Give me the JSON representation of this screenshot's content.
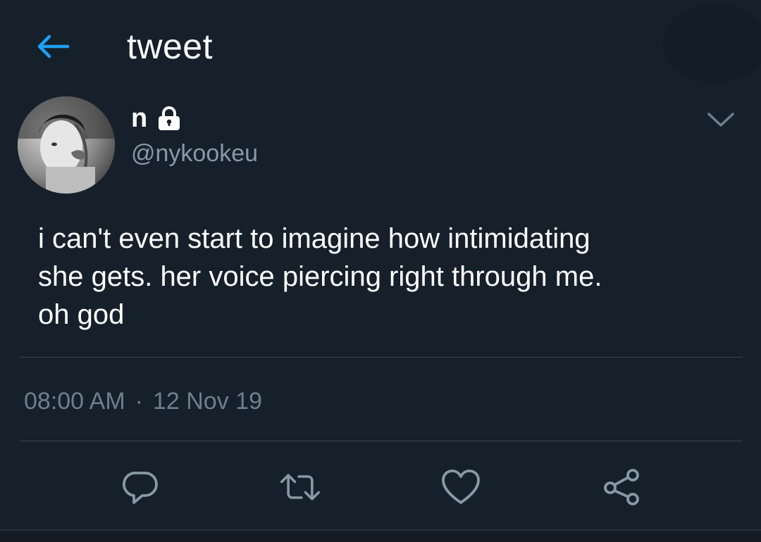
{
  "header": {
    "back_icon": "arrow-left-icon",
    "title": "tweet",
    "accent": "#1da1f2"
  },
  "tweet": {
    "author": {
      "display_name": "n",
      "protected_icon": "lock-icon",
      "handle": "@nykookeu"
    },
    "menu_icon": "chevron-down-icon",
    "text": "i can't even start to imagine how intimidating\nshe gets. her voice piercing right through me.\noh god",
    "time": "08:00 AM",
    "separator": "·",
    "date": "12 Nov 19",
    "actions": [
      {
        "name": "reply",
        "icon": "reply-icon"
      },
      {
        "name": "retweet",
        "icon": "retweet-icon"
      },
      {
        "name": "like",
        "icon": "heart-icon"
      },
      {
        "name": "share",
        "icon": "share-icon"
      }
    ]
  },
  "colors": {
    "background": "#15202b",
    "text": "#ffffff",
    "secondary_text": "#8899a6",
    "divider": "#38444d"
  }
}
